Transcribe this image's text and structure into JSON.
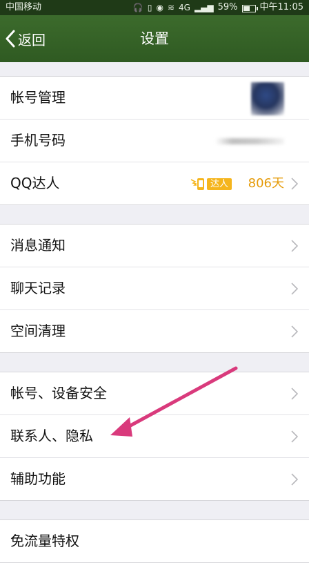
{
  "status_bar": {
    "carrier": "中国移动",
    "battery": "59%",
    "battery_level": 0.59,
    "network": "4G",
    "time": "中午11:05"
  },
  "header": {
    "back_label": "返回",
    "title": "设置"
  },
  "groups": [
    {
      "items": [
        {
          "label": "帐号管理"
        },
        {
          "label": "手机号码"
        },
        {
          "label": "QQ达人",
          "badge": "达人",
          "days": "806天"
        }
      ]
    },
    {
      "items": [
        {
          "label": "消息通知"
        },
        {
          "label": "聊天记录"
        },
        {
          "label": "空间清理"
        }
      ]
    },
    {
      "items": [
        {
          "label": "帐号、设备安全"
        },
        {
          "label": "联系人、隐私"
        },
        {
          "label": "辅助功能"
        }
      ]
    },
    {
      "items": [
        {
          "label": "免流量特权"
        }
      ]
    }
  ],
  "annotation": {
    "arrow_color": "#d93a7c"
  },
  "colors": {
    "header_bg": "#336024",
    "status_bg": "#1f3a17",
    "accent_days": "#e59a07"
  }
}
